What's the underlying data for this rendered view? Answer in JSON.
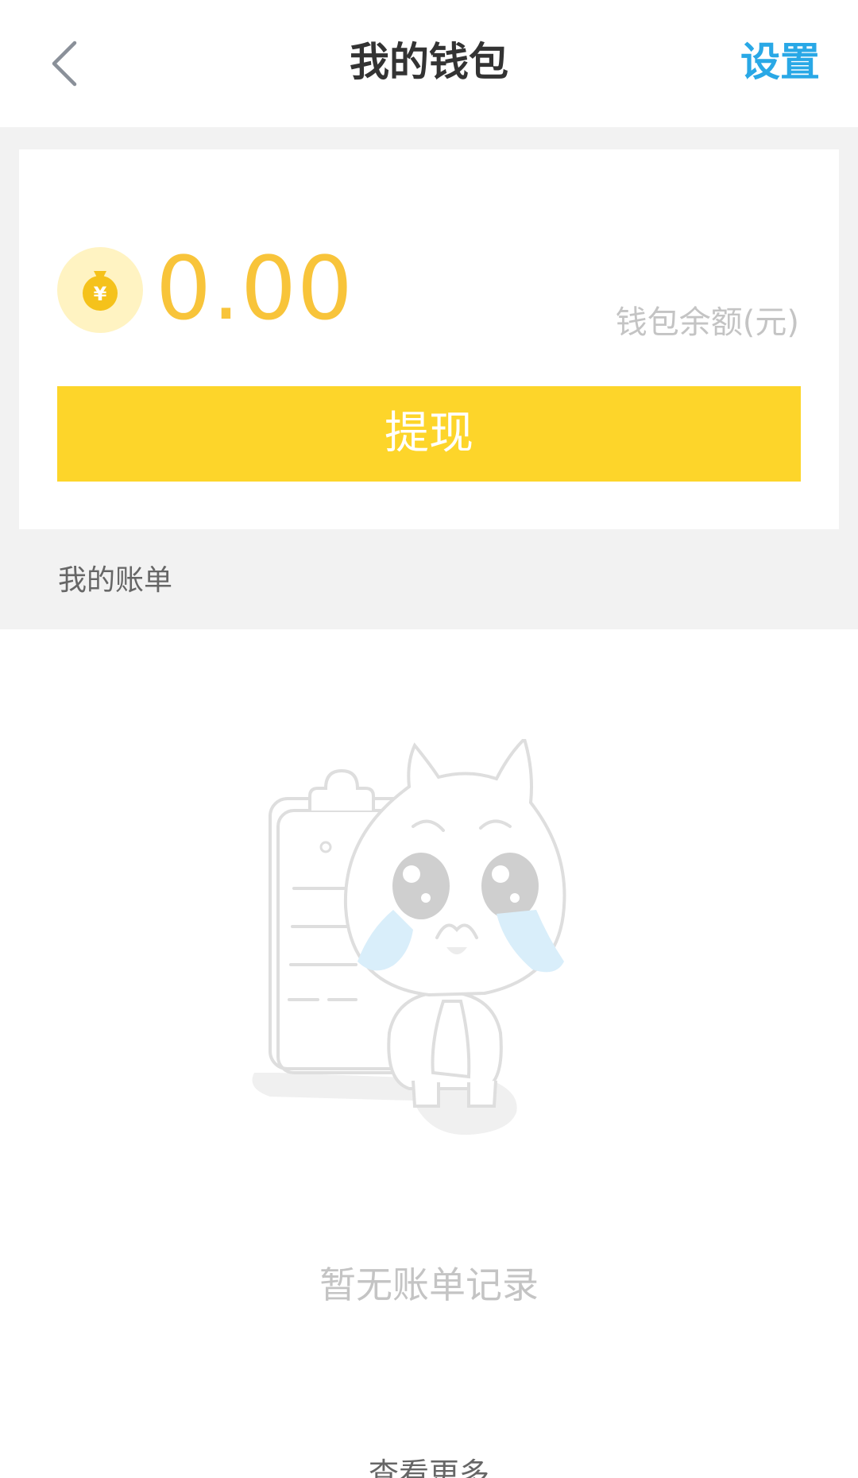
{
  "header": {
    "title": "我的钱包",
    "settings_label": "设置",
    "back_icon": "chevron-left-icon"
  },
  "wallet": {
    "balance": "0.00",
    "balance_label": "钱包余额(元)",
    "coin_icon": "money-bag-yuan-icon",
    "withdraw_label": "提现"
  },
  "bills": {
    "section_label": "我的账单",
    "empty_text": "暂无账单记录",
    "view_more_label": "查看更多",
    "empty_illustration": "crying-mascot-clipboard-illustration"
  },
  "colors": {
    "accent_blue": "#29a8e6",
    "balance_yellow": "#f8c43a",
    "button_yellow": "#fdd52a",
    "page_grey": "#f2f2f2"
  }
}
